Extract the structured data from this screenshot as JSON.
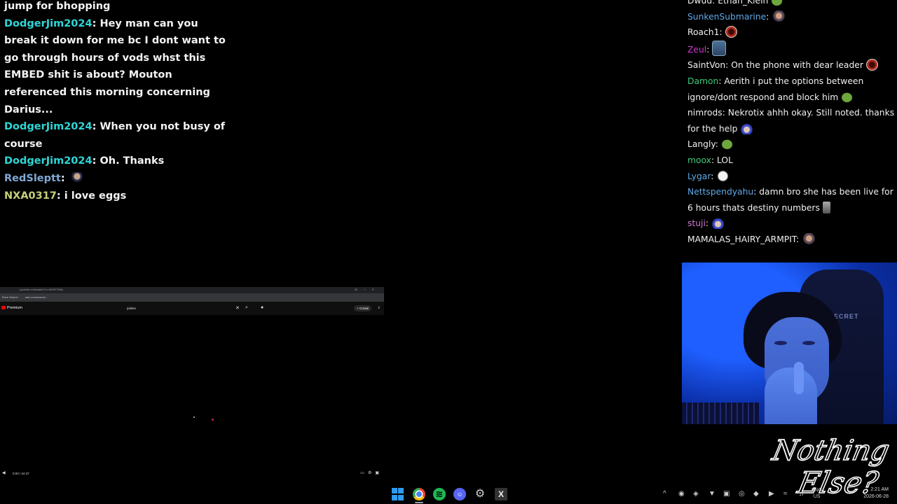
{
  "left_chat": [
    {
      "name": "",
      "text": "jump for bhopping"
    },
    {
      "name": "DodgerJim2024",
      "name_color": "#2ed6d6",
      "text": "Hey man can you break it down for me bc I dont want to go through hours of vods whst this EMBED shit is about? Mouton referenced this morning concerning Darius..."
    },
    {
      "name": "DodgerJim2024",
      "name_color": "#2ed6d6",
      "text": "When you not busy of course"
    },
    {
      "name": "DodgerJim2024",
      "name_color": "#2ed6d6",
      "text": "Oh. Thanks"
    },
    {
      "name": "RedSleptt",
      "name_color": "#7fa9d6",
      "text": "",
      "emote": "pirate-emote"
    },
    {
      "name": "NXA0317",
      "name_color": "#c8d07a",
      "text": "i love eggs"
    }
  ],
  "browser": {
    "url": "youtube.com/watch?v=JxKflYT64tc",
    "bookmarks": [
      "Rock Search",
      "ask.com/search/..."
    ],
    "logo_text": "Premium",
    "search_value": "jubilee",
    "create_label": "+ Create",
    "time_display": "0:00 / 24:37"
  },
  "right_chat": [
    {
      "name": "Dwud",
      "name_color": "#f1f1f1",
      "text": "Ethan_Klein",
      "emote": "frog-emote"
    },
    {
      "name": "SunkenSubmarine",
      "name_color": "#5fa8e8",
      "text": "",
      "emote": "man-emote"
    },
    {
      "name": "Roach1",
      "name_color": "#f1f1f1",
      "text": "",
      "emote": "orb-emote"
    },
    {
      "name": "Zeul",
      "name_color": "#d03ad0",
      "text": "",
      "emote": "face-emote"
    },
    {
      "name": "SaintVon",
      "name_color": "#f1f1f1",
      "text": "On the phone with dear leader",
      "emote": "orb-emote"
    },
    {
      "name": "Damon",
      "name_color": "#3ec97a",
      "text": "Aerith i put the options between ignore/dont respond and block him",
      "emote": "frog-emote"
    },
    {
      "name": "nimrods",
      "name_color": "#f1f1f1",
      "text": "Nekrotix ahhh okay. Still noted. thanks for the help",
      "emote": "hat-emote"
    },
    {
      "name": "Langly",
      "name_color": "#f1f1f1",
      "text": "",
      "emote": "frog-emote"
    },
    {
      "name": "moox",
      "name_color": "#3ec97a",
      "text": "LOL",
      "emote": ""
    },
    {
      "name": "Lygar",
      "name_color": "#5fa8e8",
      "text": "",
      "emote": "ghost-emote"
    },
    {
      "name": "Nettspendyahu",
      "name_color": "#5fa8e8",
      "text": "damn bro she has been live for 6 hours thats destiny numbers",
      "emote": "grey-emote"
    },
    {
      "name": "stuji",
      "name_color": "#d07ad0",
      "text": "",
      "emote": "hat-emote"
    },
    {
      "name": "MAMALAS_HAIRY_ARMPIT",
      "name_color": "#f1f1f1",
      "text": "",
      "emote": "man-emote"
    }
  ],
  "webcam": {
    "chair_text": "SECRET"
  },
  "logo": {
    "line1": "Nothing",
    "line2": "Else?"
  },
  "taskbar": {
    "apps": [
      "windows-start",
      "chrome",
      "spotify",
      "discord",
      "steam",
      "obs"
    ],
    "language": "ENG",
    "region": "US",
    "time": "2:21 AM",
    "date": "2026-06-28"
  }
}
